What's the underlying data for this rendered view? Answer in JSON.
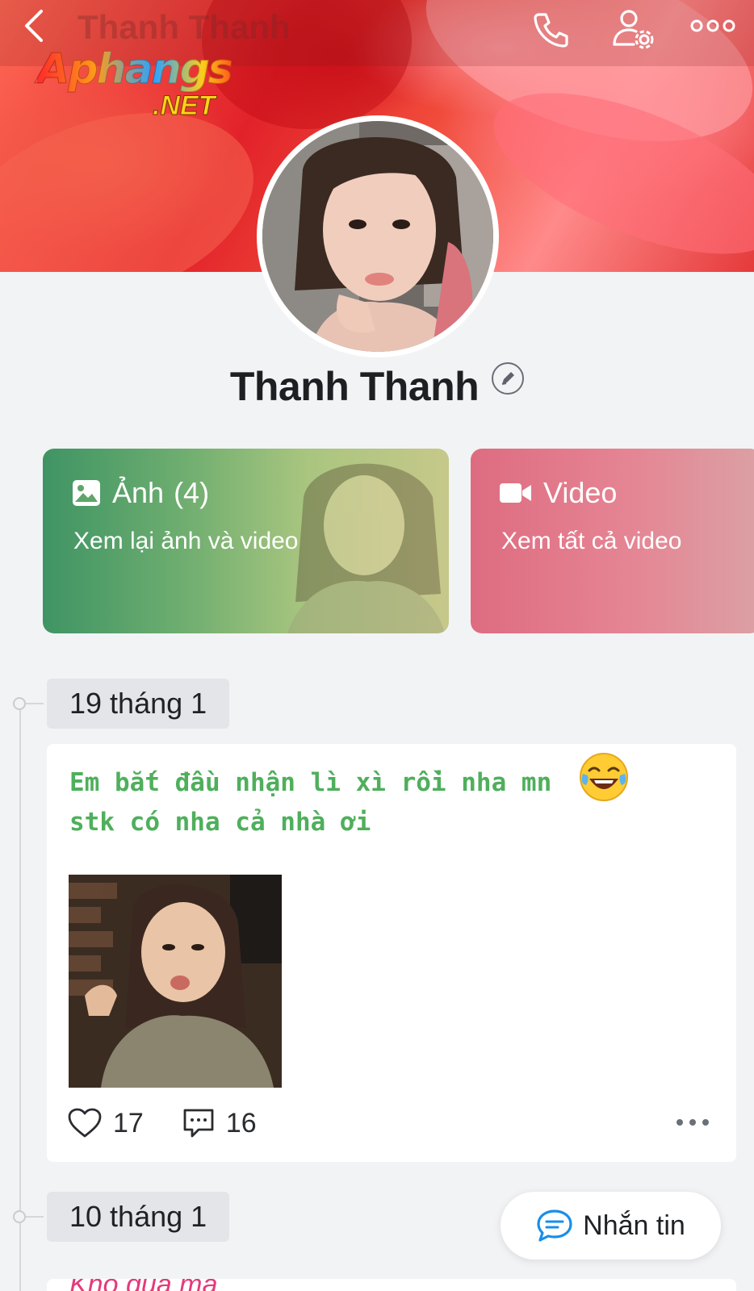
{
  "header": {
    "title": "Thanh Thanh",
    "back_icon": "chevron-left-icon",
    "call_icon": "phone-icon",
    "settings_icon": "user-gear-icon",
    "more_icon": "more-dots-icon"
  },
  "watermark": {
    "main": "Aphangs",
    "sub": ".NET"
  },
  "profile": {
    "name": "Thanh Thanh",
    "edit_icon": "pencil-icon"
  },
  "cards": {
    "photo": {
      "title": "Ảnh",
      "count": "(4)",
      "subtitle": "Xem lại ảnh và video",
      "icon": "image-icon"
    },
    "video": {
      "title": "Video",
      "subtitle": "Xem tất cả video",
      "icon": "video-camera-icon"
    }
  },
  "timeline": [
    {
      "date": "19 tháng 1",
      "post": {
        "text_line1": "Em bắt đầu nhận lì xì rồi nha mn",
        "text_line2": "stk có nha cả nhà ơi",
        "emoji": "tears-of-joy-emoji",
        "likes": "17",
        "comments": "16"
      }
    },
    {
      "date": "10 tháng 1",
      "post": {
        "text_peek": "Khổ quá mà"
      }
    }
  ],
  "message_button": {
    "label": "Nhắn tin",
    "icon": "chat-bubble-icon"
  },
  "colors": {
    "post_text": "#4faf5c",
    "photo_card": "#4f9f68",
    "video_card": "#e07a8a",
    "accent_blue": "#1a8ee8"
  }
}
